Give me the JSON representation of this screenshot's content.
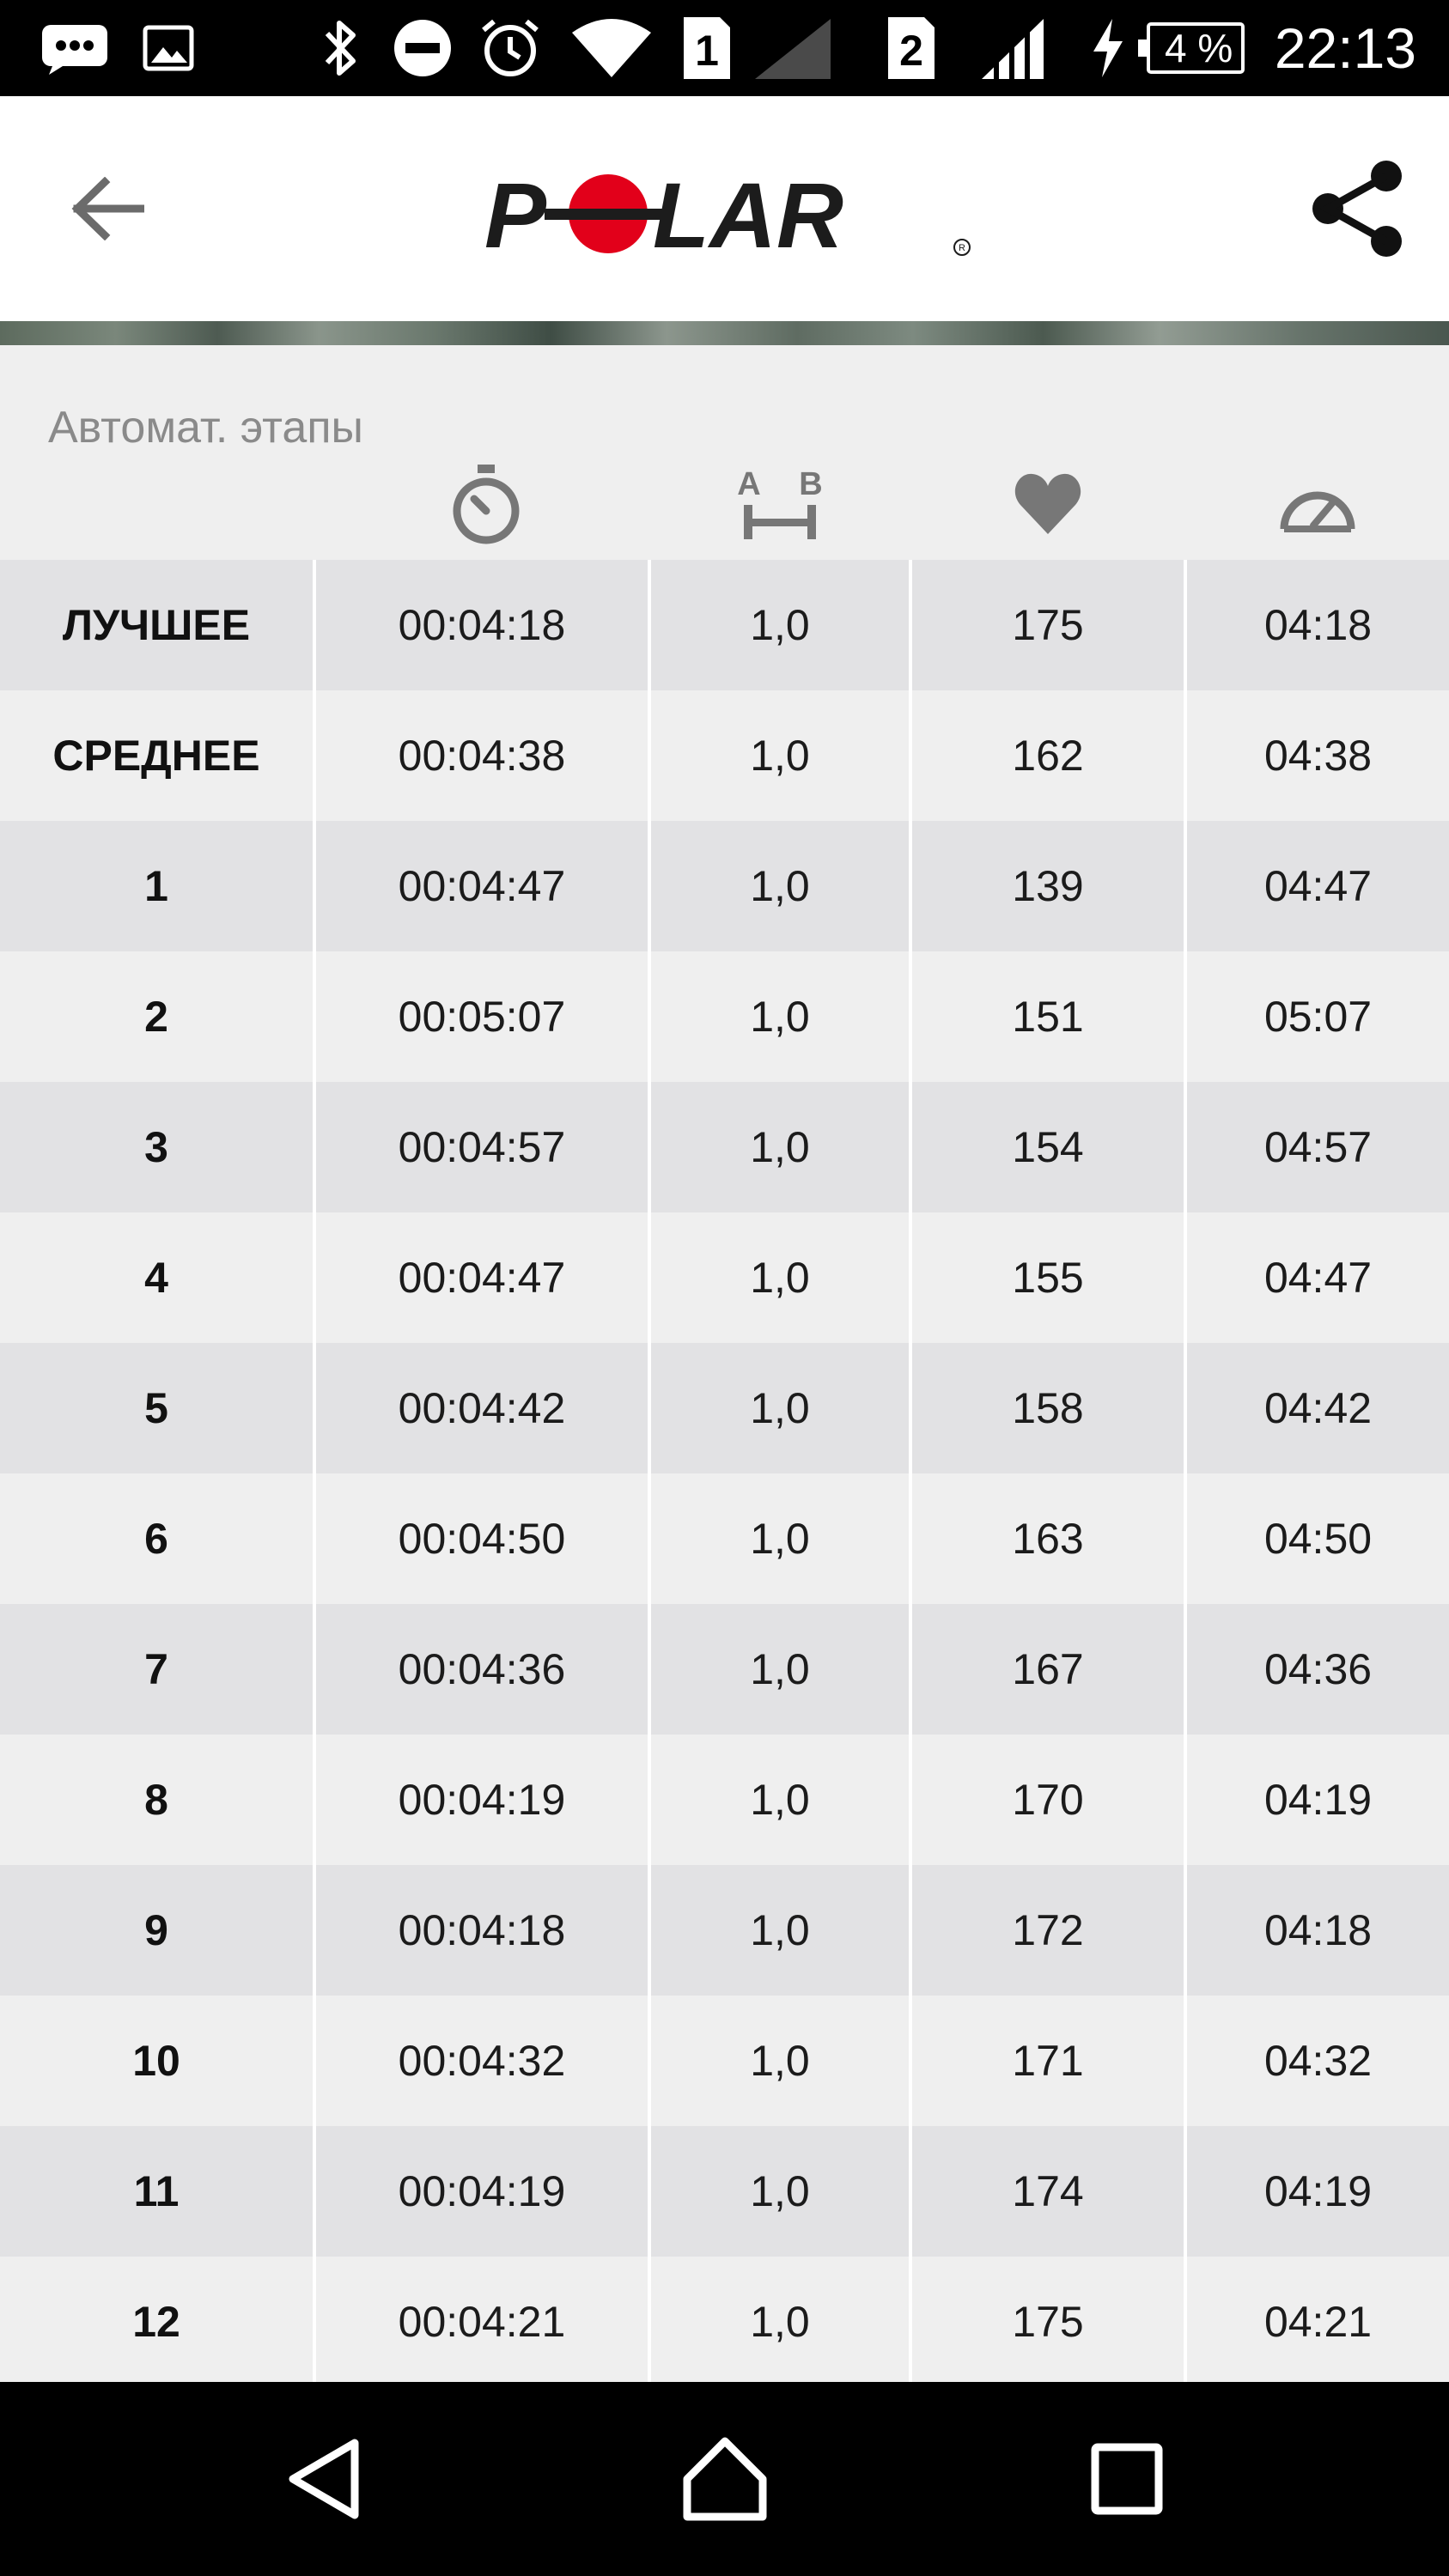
{
  "status_bar": {
    "time": "22:13",
    "battery_text": "4 %",
    "sim1": "1",
    "sim2": "2",
    "icons": [
      "chat-icon",
      "image-icon",
      "bluetooth-icon",
      "do-not-disturb-icon",
      "alarm-icon",
      "wifi-icon",
      "signal-icon",
      "charging-icon",
      "battery-icon"
    ]
  },
  "app_bar": {
    "logo_text": "POLAR",
    "back_icon": "arrow-back-icon",
    "share_icon": "share-icon"
  },
  "laps": {
    "section_title": "Автомат. этапы",
    "column_icons": [
      "stopwatch-icon",
      "distance-a-b-icon",
      "heart-icon",
      "speedometer-icon"
    ],
    "column_icon_text": {
      "a": "A",
      "b": "B"
    },
    "rows": [
      {
        "label": "ЛУЧШЕЕ",
        "time": "00:04:18",
        "distance": "1,0",
        "heart_rate": "175",
        "pace": "04:18"
      },
      {
        "label": "СРЕДНЕЕ",
        "time": "00:04:38",
        "distance": "1,0",
        "heart_rate": "162",
        "pace": "04:38"
      },
      {
        "label": "1",
        "time": "00:04:47",
        "distance": "1,0",
        "heart_rate": "139",
        "pace": "04:47"
      },
      {
        "label": "2",
        "time": "00:05:07",
        "distance": "1,0",
        "heart_rate": "151",
        "pace": "05:07"
      },
      {
        "label": "3",
        "time": "00:04:57",
        "distance": "1,0",
        "heart_rate": "154",
        "pace": "04:57"
      },
      {
        "label": "4",
        "time": "00:04:47",
        "distance": "1,0",
        "heart_rate": "155",
        "pace": "04:47"
      },
      {
        "label": "5",
        "time": "00:04:42",
        "distance": "1,0",
        "heart_rate": "158",
        "pace": "04:42"
      },
      {
        "label": "6",
        "time": "00:04:50",
        "distance": "1,0",
        "heart_rate": "163",
        "pace": "04:50"
      },
      {
        "label": "7",
        "time": "00:04:36",
        "distance": "1,0",
        "heart_rate": "167",
        "pace": "04:36"
      },
      {
        "label": "8",
        "time": "00:04:19",
        "distance": "1,0",
        "heart_rate": "170",
        "pace": "04:19"
      },
      {
        "label": "9",
        "time": "00:04:18",
        "distance": "1,0",
        "heart_rate": "172",
        "pace": "04:18"
      },
      {
        "label": "10",
        "time": "00:04:32",
        "distance": "1,0",
        "heart_rate": "171",
        "pace": "04:32"
      },
      {
        "label": "11",
        "time": "00:04:19",
        "distance": "1,0",
        "heart_rate": "174",
        "pace": "04:19"
      },
      {
        "label": "12",
        "time": "00:04:21",
        "distance": "1,0",
        "heart_rate": "175",
        "pace": "04:21"
      }
    ]
  },
  "nav_bar": {
    "icons": [
      "nav-back-icon",
      "nav-home-icon",
      "nav-recents-icon"
    ]
  },
  "colors": {
    "brand_red": "#e2001a",
    "row_dark": "#e2e2e4",
    "row_light": "#efefef"
  }
}
